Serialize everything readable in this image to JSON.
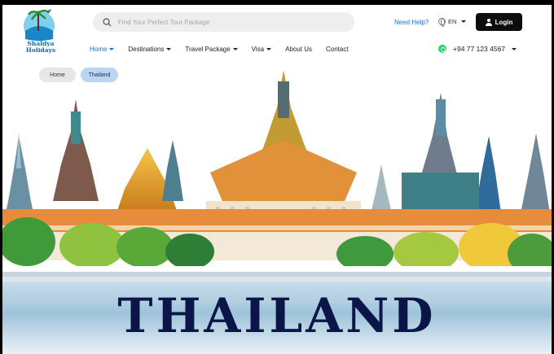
{
  "logo": {
    "line1": "Shaldya",
    "line2": "Holidays"
  },
  "search": {
    "placeholder": "Find Your Perfect Tour Package"
  },
  "header": {
    "need_help": "Need Help?",
    "language": "EN",
    "login_label": "Login"
  },
  "nav": {
    "items": [
      {
        "label": "Home",
        "dropdown": true,
        "active": true
      },
      {
        "label": "Destinations",
        "dropdown": true
      },
      {
        "label": "Travel Package",
        "dropdown": true
      },
      {
        "label": "Visa",
        "dropdown": true
      },
      {
        "label": "About Us",
        "dropdown": false
      },
      {
        "label": "Contact",
        "dropdown": false
      }
    ]
  },
  "contact": {
    "phone": "+94 77 123 4567"
  },
  "breadcrumb": {
    "home": "Home",
    "current": "Thailand"
  },
  "hero": {
    "title": "THAILAND"
  },
  "colors": {
    "accent": "#1f6fd6",
    "title": "#0b1547",
    "button": "#0d0d0d",
    "whatsapp": "#25d366"
  }
}
